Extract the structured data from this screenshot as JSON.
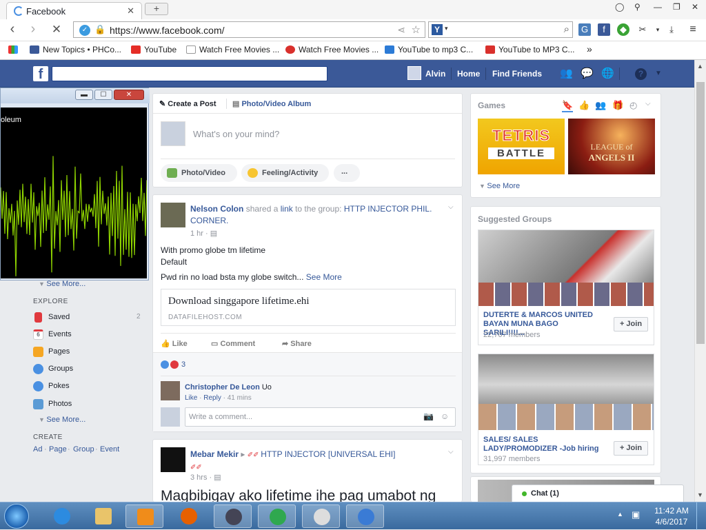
{
  "browser": {
    "tab_title": "Facebook",
    "url": "https://www.facebook.com/",
    "bookmarks": [
      {
        "label": "New Topics • PHCo...",
        "color": "#3b5998"
      },
      {
        "label": "YouTube",
        "color": "#e52d27"
      },
      {
        "label": "Watch Free Movies ...",
        "color": "#cccccc"
      },
      {
        "label": "Watch Free Movies ...",
        "color": "#d9302c"
      },
      {
        "label": "YouTube to mp3 C...",
        "color": "#2c7bd6"
      },
      {
        "label": "YouTube to MP3 C...",
        "color": "#d9302c"
      }
    ],
    "bookmarks_overflow": "»"
  },
  "fb_header": {
    "user_name": "Alvin",
    "home": "Home",
    "find_friends": "Find Friends"
  },
  "left_nav": {
    "see_more_top": "See More...",
    "explore_heading": "EXPLORE",
    "explore_items": [
      {
        "label": "Saved",
        "count": "2",
        "color": "#e0393e"
      },
      {
        "label": "Events",
        "count": "",
        "color": "#e0393e",
        "glyph": "6"
      },
      {
        "label": "Pages",
        "count": "",
        "color": "#f5a623"
      },
      {
        "label": "Groups",
        "count": "",
        "color": "#4a90e2"
      },
      {
        "label": "Pokes",
        "count": "",
        "color": "#4a90e2"
      },
      {
        "label": "Photos",
        "count": "",
        "color": "#5b9bd5"
      }
    ],
    "see_more_bottom": "See More...",
    "create_heading": "CREATE",
    "create_links": [
      "Ad",
      "Page",
      "Group",
      "Event"
    ]
  },
  "media_player": {
    "title_fragment": "oleum"
  },
  "composer": {
    "create_post": "Create a Post",
    "photo_video_album": "Photo/Video Album",
    "placeholder": "What's on your mind?",
    "photo_video": "Photo/Video",
    "feeling_activity": "Feeling/Activity",
    "more": "..."
  },
  "post1": {
    "author": "Nelson Colon",
    "shared_a": "shared a",
    "link_word": "link",
    "to_group": "to the group:",
    "group_name": "HTTP INJECTOR PHIL. CORNER.",
    "time": "1 hr",
    "line1": "With promo globe tm lifetime",
    "line2": "Default",
    "line3": "Pwd rin no load bsta my globe switch...",
    "see_more": "See More",
    "attachment_title": "Download singgapore lifetime.ehi",
    "attachment_domain": "DATAFILEHOST.COM",
    "like": "Like",
    "comment": "Comment",
    "share": "Share",
    "reactions_count": "3",
    "comment_author": "Christopher De Leon",
    "comment_text": "Uo",
    "comment_like": "Like",
    "comment_reply": "Reply",
    "comment_time": "41 mins",
    "write_comment": "Write a comment..."
  },
  "post2": {
    "author": "Mebar Mekir",
    "group_name": "HTTP INJECTOR [UNIVERSAL EHI]",
    "time": "3 hrs",
    "text": "Magbibigay ako lifetime ihe pag umabot ng"
  },
  "games": {
    "heading": "Games",
    "tetris_line1": "TETRIS",
    "tetris_line2": "BATTLE",
    "league_line1": "LEAGUE of",
    "league_line2": "ANGELS II",
    "see_more": "See More"
  },
  "suggested_groups": {
    "heading": "Suggested Groups",
    "groups": [
      {
        "name": "DUTERTE & MARCOS UNITED BAYAN MUNA BAGO SARILI!!!!...",
        "members": "22,707 members",
        "join": "Join"
      },
      {
        "name": "SALES/ SALES LADY/PROMODIZER -Job hiring",
        "members": "31,997 members",
        "join": "Join"
      }
    ]
  },
  "chat": {
    "label": "Chat (1)"
  },
  "taskbar": {
    "time": "11:42 AM",
    "date": "4/6/2017"
  }
}
